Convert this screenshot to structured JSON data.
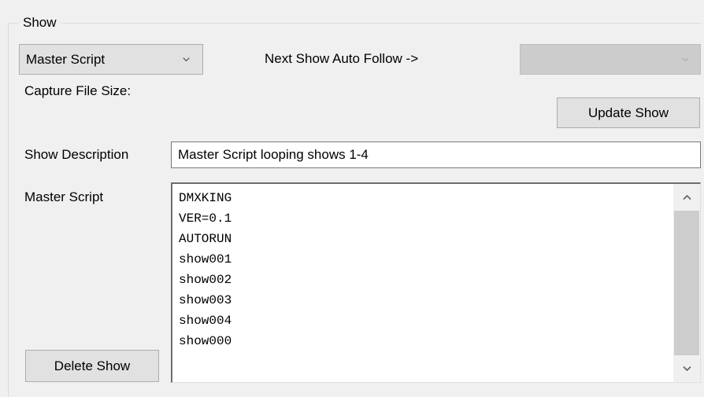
{
  "group": {
    "title": "Show"
  },
  "show_select": {
    "value": "Master Script",
    "icon": "chevron-down-icon"
  },
  "next_show": {
    "label": "Next Show Auto Follow ->",
    "value": "",
    "icon": "chevron-down-icon"
  },
  "capture": {
    "label": "Capture File Size:"
  },
  "buttons": {
    "update_show": "Update Show",
    "delete_show": "Delete Show"
  },
  "description": {
    "label": "Show Description",
    "value": "Master Script looping shows 1-4"
  },
  "master_script": {
    "label": "Master Script",
    "lines": [
      "DMXKING",
      "VER=0.1",
      "AUTORUN",
      "show001",
      "show002",
      "show003",
      "show004",
      "show000"
    ]
  },
  "scrollbar": {
    "up_icon": "scroll-up-arrow-icon",
    "down_icon": "scroll-down-arrow-icon"
  }
}
